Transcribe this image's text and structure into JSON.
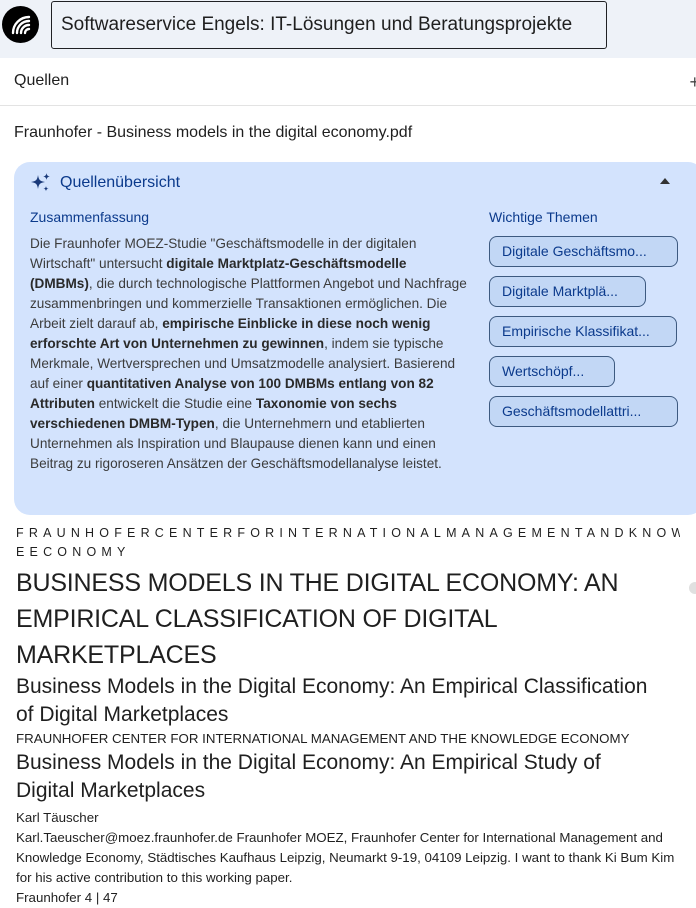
{
  "header": {
    "title": "Softwareservice Engels: IT-Lösungen und Beratungsprojekte",
    "logo_icon": "broadcast-waves-icon"
  },
  "sources": {
    "label": "Quellen",
    "file_name": "Fraunhofer - Business models in the digital economy.pdf"
  },
  "overview": {
    "title": "Quellenübersicht",
    "summary_label": "Zusammenfassung",
    "themes_label": "Wichtige Themen",
    "summary_parts": [
      {
        "t": "Die Fraunhofer MOEZ-Studie \"Geschäftsmodelle in der digitalen Wirtschaft\" untersucht ",
        "b": false
      },
      {
        "t": "digitale Marktplatz-Geschäftsmodelle (DMBMs)",
        "b": true
      },
      {
        "t": ", die durch technologische Plattformen Angebot und Nachfrage zusammenbringen und kommerzielle Transaktionen ermöglichen. Die Arbeit zielt darauf ab, ",
        "b": false
      },
      {
        "t": "empirische Einblicke in diese noch wenig erforschte Art von Unternehmen zu gewinnen",
        "b": true
      },
      {
        "t": ", indem sie typische Merkmale, Wertversprechen und Umsatzmodelle analysiert. Basierend auf einer ",
        "b": false
      },
      {
        "t": "quantitativen Analyse von 100 DMBMs entlang von 82 Attributen",
        "b": true
      },
      {
        "t": " entwickelt die Studie eine ",
        "b": false
      },
      {
        "t": "Taxonomie von sechs verschiedenen DMBM-Typen",
        "b": true
      },
      {
        "t": ", die Unternehmern und etablierten Unternehmen als Inspiration und Blaupause dienen kann und einen Beitrag zu rigoroseren Ansätzen der Geschäftsmodellanalyse leistet.",
        "b": false
      }
    ],
    "themes": [
      "Digitale Geschäftsmo...",
      "Digitale Marktplä...",
      "Empirische Klassifikat...",
      "Wertschöpf...",
      "Geschäftsmodellattri..."
    ]
  },
  "document": {
    "spaced_line_1": "FRAUNHOFERCENTERFORINTERNATIONALMANAGEMENTANDKNOWLEDG",
    "spaced_line_2": "EECONOMY",
    "main_title_lines": [
      "BUSINESS MODELS IN THE DIGITAL ECONOMY: AN",
      "EMPIRICAL CLASSIFICATION OF DIGITAL",
      "MARKETPLACES"
    ],
    "subtitle_1_lines": [
      "Business Models in the Digital Economy: An Empirical Classification",
      "of Digital Marketplaces"
    ],
    "center_line": "FRAUNHOFER CENTER FOR INTERNATIONAL MANAGEMENT AND THE KNOWLEDGE ECONOMY",
    "subtitle_2_lines": [
      "Business Models in the Digital Economy: An Empirical Study of",
      "Digital Marketplaces"
    ],
    "author": "Karl Täuscher",
    "affiliation": "Karl.Taeuscher@moez.fraunhofer.de Fraunhofer MOEZ, Fraunhofer Center for International Management and Knowledge Economy, Städtisches Kaufhaus Leipzig, Neumarkt 9-19, 04109 Leipzig. I want to thank Ki Bum Kim for his active contribution to this working paper.",
    "page_indicator": "Fraunhofer 4 | 47"
  }
}
